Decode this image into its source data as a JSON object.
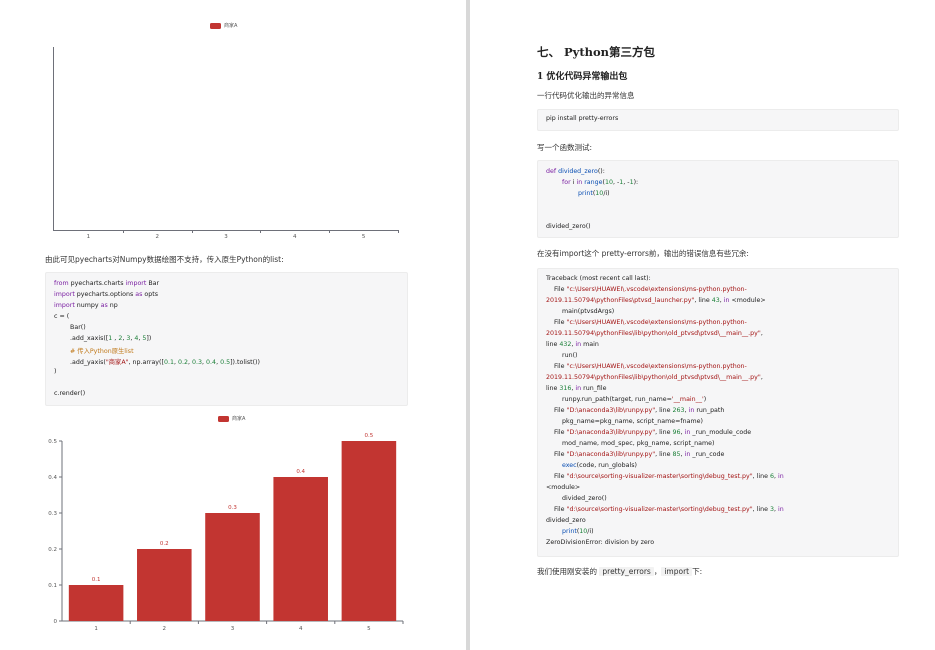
{
  "left_page": {
    "chart1": {
      "legend": "商家A",
      "x_ticks": [
        "1",
        "2",
        "3",
        "4",
        "5"
      ]
    },
    "text1": "由此可见pyecharts对Numpy数据绘图不支持，传入原生Python的list:",
    "code1": {
      "lines": [
        [
          [
            "kw",
            "from "
          ],
          [
            "",
            "pyecharts.charts "
          ],
          [
            "kw",
            "import "
          ],
          [
            "",
            "Bar"
          ]
        ],
        [
          [
            "kw",
            "import "
          ],
          [
            "",
            "pyecharts.options "
          ],
          [
            "kw",
            "as "
          ],
          [
            "",
            "opts"
          ]
        ],
        [
          [
            "kw",
            "import "
          ],
          [
            "",
            "numpy "
          ],
          [
            "kw",
            "as "
          ],
          [
            "",
            "np"
          ]
        ],
        [
          [
            "",
            "c = ("
          ]
        ],
        [
          [
            "",
            "        Bar()"
          ]
        ],
        [
          [
            "",
            "        .add_xaxis(["
          ],
          [
            "num",
            "1"
          ],
          [
            "",
            " , "
          ],
          [
            "num",
            "2"
          ],
          [
            "",
            ", "
          ],
          [
            "num",
            "3"
          ],
          [
            "",
            ", "
          ],
          [
            "num",
            "4"
          ],
          [
            "",
            ", "
          ],
          [
            "num",
            "5"
          ],
          [
            "",
            "])"
          ]
        ],
        [
          [
            "cm",
            "        # 传入Python原生list"
          ]
        ],
        [
          [
            "",
            "        .add_yaxis("
          ],
          [
            "str",
            "\"商家A\""
          ],
          [
            "",
            ", np.array(["
          ],
          [
            "num",
            "0.1"
          ],
          [
            "",
            ", "
          ],
          [
            "num",
            "0.2"
          ],
          [
            "",
            ", "
          ],
          [
            "num",
            "0.3"
          ],
          [
            "",
            ", "
          ],
          [
            "num",
            "0.4"
          ],
          [
            "",
            ", "
          ],
          [
            "num",
            "0.5"
          ],
          [
            "",
            "]).tolist())"
          ]
        ],
        [
          [
            "",
            ")"
          ]
        ],
        [
          [
            "",
            ""
          ]
        ],
        [
          [
            "",
            "c.render()"
          ]
        ]
      ]
    },
    "chart2": {
      "legend": "商家A"
    }
  },
  "right_page": {
    "section_title": "七、 Python第三方包",
    "sub_title": "1 优化代码异常输出包",
    "desc1": "一行代码优化输出的异常信息",
    "code_pip": "pip install pretty-errors",
    "desc2": "写一个函数测试:",
    "code_test": {
      "lines": [
        [
          [
            "kw",
            "def "
          ],
          [
            "fn",
            "divided_zero"
          ],
          [
            "",
            "():"
          ]
        ],
        [
          [
            "",
            "        "
          ],
          [
            "kw",
            "for "
          ],
          [
            "",
            "i "
          ],
          [
            "kw",
            "in "
          ],
          [
            "fn",
            "range"
          ],
          [
            "",
            "("
          ],
          [
            "num",
            "10"
          ],
          [
            "",
            ", -"
          ],
          [
            "num",
            "1"
          ],
          [
            "",
            ", -"
          ],
          [
            "num",
            "1"
          ],
          [
            "",
            "):"
          ]
        ],
        [
          [
            "",
            "                "
          ],
          [
            "fn",
            "print"
          ],
          [
            "",
            "("
          ],
          [
            "num",
            "10"
          ],
          [
            "",
            "/i)"
          ]
        ],
        [
          [
            "",
            ""
          ]
        ],
        [
          [
            "",
            ""
          ]
        ],
        [
          [
            "",
            "divided_zero()"
          ]
        ]
      ]
    },
    "desc3": "在没有import这个 pretty-errors前，输出的错误信息有些冗余:",
    "traceback": {
      "lines": [
        [
          [
            "",
            "Traceback (most recent call last):"
          ]
        ],
        [
          [
            "",
            "    File "
          ],
          [
            "str",
            "\"c:\\Users\\HUAWEI\\.vscode\\extensions\\ms-python.python-"
          ]
        ],
        [
          [
            "str",
            "2019.11.50794\\pythonFiles\\ptvsd_launcher.py\""
          ],
          [
            "",
            ", line "
          ],
          [
            "num",
            "43"
          ],
          [
            "",
            ", "
          ],
          [
            "kw",
            "in "
          ],
          [
            "",
            "<module>"
          ]
        ],
        [
          [
            "",
            "        main(ptvsdArgs)"
          ]
        ],
        [
          [
            "",
            "    File "
          ],
          [
            "str",
            "\"c:\\Users\\HUAWEI\\.vscode\\extensions\\ms-python.python-"
          ]
        ],
        [
          [
            "str",
            "2019.11.50794\\pythonFiles\\lib\\python\\old_ptvsd\\ptvsd\\__main__.py\""
          ],
          [
            "",
            ","
          ]
        ],
        [
          [
            "",
            "line "
          ],
          [
            "num",
            "432"
          ],
          [
            "",
            ", "
          ],
          [
            "kw",
            "in "
          ],
          [
            "",
            "main"
          ]
        ],
        [
          [
            "",
            "        run()"
          ]
        ],
        [
          [
            "",
            "    File "
          ],
          [
            "str",
            "\"c:\\Users\\HUAWEI\\.vscode\\extensions\\ms-python.python-"
          ]
        ],
        [
          [
            "str",
            "2019.11.50794\\pythonFiles\\lib\\python\\old_ptvsd\\ptvsd\\__main__.py\""
          ],
          [
            "",
            ","
          ]
        ],
        [
          [
            "",
            "line "
          ],
          [
            "num",
            "316"
          ],
          [
            "",
            ", "
          ],
          [
            "kw",
            "in "
          ],
          [
            "",
            "run_file"
          ]
        ],
        [
          [
            "",
            "        runpy.run_path(target, run_name="
          ],
          [
            "str",
            "'__main__'"
          ],
          [
            "",
            ")"
          ]
        ],
        [
          [
            "",
            "    File "
          ],
          [
            "str",
            "\"D:\\anaconda3\\lib\\runpy.py\""
          ],
          [
            "",
            ", line "
          ],
          [
            "num",
            "263"
          ],
          [
            "",
            ", "
          ],
          [
            "kw",
            "in "
          ],
          [
            "",
            "run_path"
          ]
        ],
        [
          [
            "",
            "        pkg_name=pkg_name, script_name=fname)"
          ]
        ],
        [
          [
            "",
            "    File "
          ],
          [
            "str",
            "\"D:\\anaconda3\\lib\\runpy.py\""
          ],
          [
            "",
            ", line "
          ],
          [
            "num",
            "96"
          ],
          [
            "",
            ", "
          ],
          [
            "kw",
            "in "
          ],
          [
            "",
            "_run_module_code"
          ]
        ],
        [
          [
            "",
            "        mod_name, mod_spec, pkg_name, script_name)"
          ]
        ],
        [
          [
            "",
            "    File "
          ],
          [
            "str",
            "\"D:\\anaconda3\\lib\\runpy.py\""
          ],
          [
            "",
            ", line "
          ],
          [
            "num",
            "85"
          ],
          [
            "",
            ", "
          ],
          [
            "kw",
            "in "
          ],
          [
            "",
            "_run_code"
          ]
        ],
        [
          [
            "",
            "        "
          ],
          [
            "fn",
            "exec"
          ],
          [
            "",
            "(code, run_globals)"
          ]
        ],
        [
          [
            "",
            "    File "
          ],
          [
            "str",
            "\"d:\\source\\sorting-visualizer-master\\sorting\\debug_test.py\""
          ],
          [
            "",
            ", line "
          ],
          [
            "num",
            "6"
          ],
          [
            "",
            ", "
          ],
          [
            "kw",
            "in"
          ]
        ],
        [
          [
            "",
            "<module>"
          ]
        ],
        [
          [
            "",
            "        divided_zero()"
          ]
        ],
        [
          [
            "",
            "    File "
          ],
          [
            "str",
            "\"d:\\source\\sorting-visualizer-master\\sorting\\debug_test.py\""
          ],
          [
            "",
            ", line "
          ],
          [
            "num",
            "3"
          ],
          [
            "",
            ", "
          ],
          [
            "kw",
            "in"
          ]
        ],
        [
          [
            "",
            "divided_zero"
          ]
        ],
        [
          [
            "",
            "        "
          ],
          [
            "fn",
            "print"
          ],
          [
            "",
            "("
          ],
          [
            "num",
            "10"
          ],
          [
            "",
            "/i)"
          ]
        ],
        [
          [
            "",
            "ZeroDivisionError: division by zero"
          ]
        ]
      ]
    },
    "desc4_prefix": "我们使用刚安装的",
    "desc4_code": "pretty_errors",
    "desc4_mid": "，",
    "desc4_code2": "import",
    "desc4_suffix": "下:"
  },
  "chart_data": [
    {
      "type": "bar",
      "categories": [
        "1",
        "2",
        "3",
        "4",
        "5"
      ],
      "series": [
        {
          "name": "商家A",
          "values": []
        }
      ],
      "title": "",
      "xlabel": "",
      "ylabel": "",
      "legend": "top-center",
      "colors": {
        "bar": "#c23531",
        "axis": "#6e7079"
      }
    },
    {
      "type": "bar",
      "categories": [
        "1",
        "2",
        "3",
        "4",
        "5"
      ],
      "series": [
        {
          "name": "商家A",
          "values": [
            0.1,
            0.2,
            0.3,
            0.4,
            0.5
          ]
        }
      ],
      "y_ticks": [
        "0",
        "0.1",
        "0.2",
        "0.3",
        "0.4",
        "0.5"
      ],
      "ylim": [
        0,
        0.5
      ],
      "data_labels": [
        "0.1",
        "0.2",
        "0.3",
        "0.4",
        "0.5"
      ],
      "title": "",
      "xlabel": "",
      "ylabel": "",
      "legend": "top-center",
      "colors": {
        "bar": "#c23531",
        "axis": "#6e7079"
      }
    }
  ]
}
